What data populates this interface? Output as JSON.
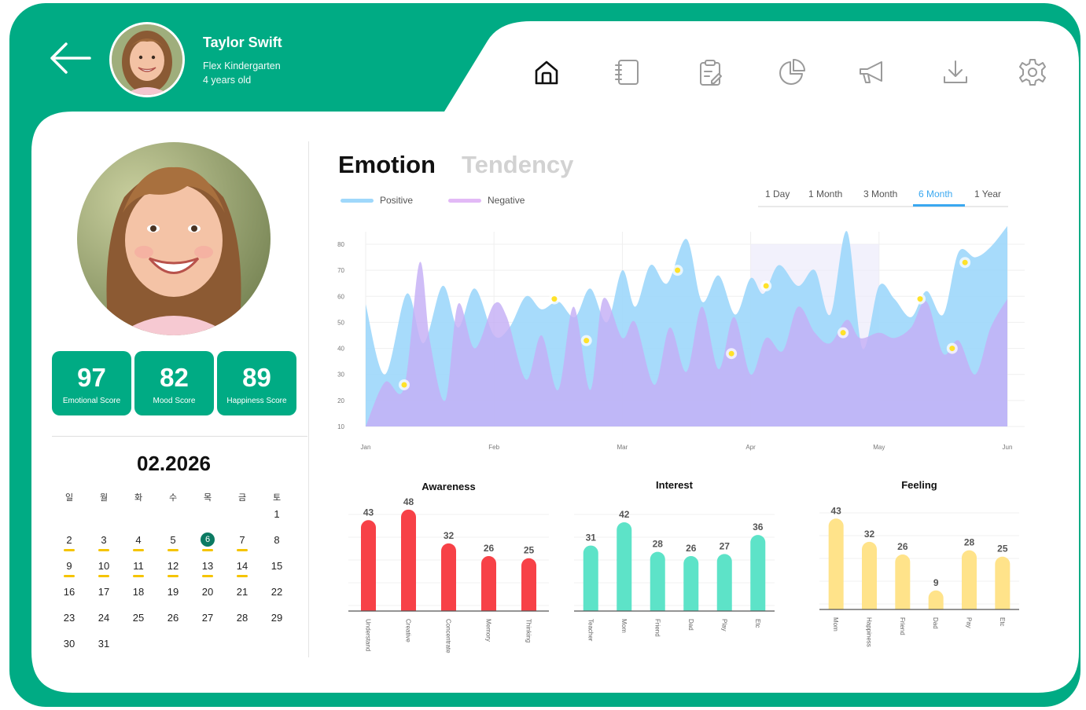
{
  "profile": {
    "name": "Taylor Swift",
    "school": "Flex Kindergarten",
    "age": "4 years old"
  },
  "nav": [
    {
      "name": "home-icon",
      "active": true
    },
    {
      "name": "notebook-icon",
      "active": false
    },
    {
      "name": "clipboard-edit-icon",
      "active": false
    },
    {
      "name": "pie-chart-icon",
      "active": false
    },
    {
      "name": "megaphone-icon",
      "active": false
    },
    {
      "name": "download-icon",
      "active": false
    },
    {
      "name": "settings-icon",
      "active": false
    }
  ],
  "scores": [
    {
      "value": "97",
      "label": "Emotional Score"
    },
    {
      "value": "82",
      "label": "Mood Score"
    },
    {
      "value": "89",
      "label": "Happiness Score"
    }
  ],
  "calendar": {
    "month": "02.2026",
    "weekdays": [
      "일",
      "월",
      "화",
      "수",
      "목",
      "금",
      "토"
    ],
    "first_weekday": 6,
    "days": 31,
    "today": 6,
    "marked": [
      2,
      3,
      4,
      5,
      6,
      7,
      9,
      10,
      11,
      12,
      13,
      14
    ]
  },
  "tabs": {
    "active": "Emotion",
    "inactive": "Tendency"
  },
  "legend": {
    "positive": "Positive",
    "negative": "Negative"
  },
  "ranges": [
    "1 Day",
    "1 Month",
    "3 Month",
    "6 Month",
    "1 Year"
  ],
  "active_range": "6 Month",
  "colors": {
    "brand": "#00ab84",
    "positive": "#9fd8fb",
    "negative": "#c5aef5",
    "accent": "#3aa8f0",
    "red": "#f74147",
    "teal": "#5de3c8",
    "yellow": "#ffe38a",
    "marker": "#ffe22a"
  },
  "chart_data": [
    {
      "type": "area",
      "x": [
        "Jan",
        "Feb",
        "Mar",
        "Apr",
        "May",
        "Jun"
      ],
      "ylim": [
        10,
        80
      ],
      "yticks": [
        10,
        20,
        30,
        40,
        50,
        60,
        70,
        80
      ],
      "highlight_range": [
        "Apr",
        "May"
      ],
      "series": [
        {
          "name": "Positive",
          "x": [
            0,
            0.15,
            0.32,
            0.45,
            0.6,
            0.72,
            0.85,
            1,
            1.12,
            1.25,
            1.37,
            1.5,
            1.63,
            1.75,
            1.88,
            2,
            2.1,
            2.22,
            2.35,
            2.5,
            2.62,
            2.75,
            2.88,
            3,
            3.1,
            3.22,
            3.37,
            3.5,
            3.62,
            3.75,
            3.87,
            4,
            4.12,
            4.25,
            4.37,
            4.5,
            4.62,
            4.75,
            4.87,
            5
          ],
          "values": [
            57,
            30,
            61,
            42,
            64,
            48,
            63,
            45,
            48,
            60,
            55,
            58,
            52,
            63,
            50,
            70,
            56,
            72,
            65,
            82,
            58,
            68,
            53,
            67,
            61,
            72,
            64,
            70,
            53,
            85,
            40,
            64,
            59,
            52,
            62,
            53,
            77,
            75,
            79,
            87
          ]
        },
        {
          "name": "Negative",
          "x": [
            0,
            0.15,
            0.3,
            0.42,
            0.5,
            0.62,
            0.72,
            0.85,
            1,
            1.1,
            1.25,
            1.37,
            1.5,
            1.62,
            1.75,
            1.85,
            2,
            2.1,
            2.25,
            2.37,
            2.5,
            2.62,
            2.75,
            2.87,
            3,
            3.12,
            3.25,
            3.37,
            3.5,
            3.62,
            3.75,
            3.85,
            4,
            4.12,
            4.25,
            4.37,
            4.5,
            4.62,
            4.75,
            4.87,
            5
          ],
          "values": [
            10,
            27,
            25,
            73,
            43,
            20,
            57,
            40,
            57,
            52,
            28,
            45,
            24,
            56,
            24,
            59,
            44,
            50,
            26,
            48,
            31,
            56,
            32,
            52,
            30,
            44,
            39,
            56,
            46,
            42,
            51,
            44,
            46,
            44,
            48,
            58,
            38,
            43,
            30,
            48,
            59
          ]
        }
      ],
      "markers": [
        {
          "x": 0.3,
          "y": 26
        },
        {
          "x": 1.47,
          "y": 59
        },
        {
          "x": 1.72,
          "y": 43
        },
        {
          "x": 2.43,
          "y": 70
        },
        {
          "x": 2.85,
          "y": 38
        },
        {
          "x": 3.12,
          "y": 64
        },
        {
          "x": 3.72,
          "y": 46
        },
        {
          "x": 4.32,
          "y": 59
        },
        {
          "x": 4.57,
          "y": 40
        },
        {
          "x": 4.67,
          "y": 73
        }
      ]
    },
    {
      "type": "bar",
      "title": "Awareness",
      "categories": [
        "Understand",
        "Creative",
        "Concentrate",
        "Memory",
        "Thinking"
      ],
      "values": [
        43,
        48,
        32,
        26,
        25
      ]
    },
    {
      "type": "bar",
      "title": "Interest",
      "categories": [
        "Teacher",
        "Mom",
        "Friend",
        "Dad",
        "Play",
        "Etc"
      ],
      "values": [
        31,
        42,
        28,
        26,
        27,
        36
      ]
    },
    {
      "type": "bar",
      "title": "Feeling",
      "categories": [
        "Mom",
        "Happiness",
        "Friend",
        "Dad",
        "Pay",
        "Etc"
      ],
      "values": [
        43,
        32,
        26,
        9,
        28,
        25
      ]
    }
  ]
}
